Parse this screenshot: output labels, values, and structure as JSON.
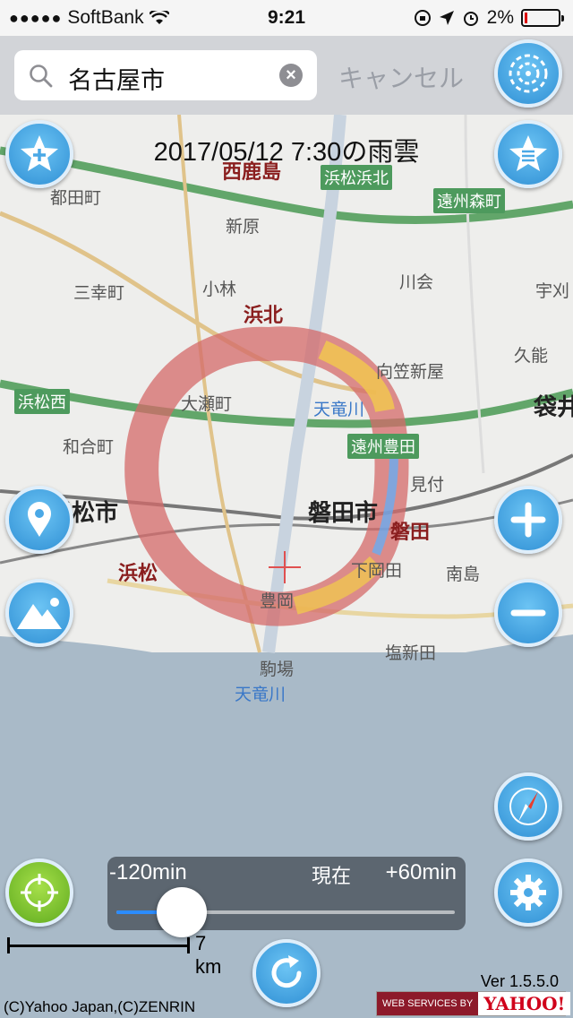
{
  "status": {
    "carrier": "SoftBank",
    "time": "9:21",
    "battery": "2%"
  },
  "search": {
    "value": "名古屋市",
    "cancel_label": "キャンセル"
  },
  "map": {
    "title": "2017/05/12 7:30の雨雲",
    "labels": [
      {
        "text": "西鹿島",
        "cls": "red"
      },
      {
        "text": "浜松浜北",
        "cls": "green"
      },
      {
        "text": "遠州森町",
        "cls": "green"
      },
      {
        "text": "新原",
        "cls": ""
      },
      {
        "text": "都田町",
        "cls": ""
      },
      {
        "text": "三幸町",
        "cls": ""
      },
      {
        "text": "小林",
        "cls": ""
      },
      {
        "text": "浜北",
        "cls": "red"
      },
      {
        "text": "川会",
        "cls": ""
      },
      {
        "text": "向笠新屋",
        "cls": ""
      },
      {
        "text": "浜松西",
        "cls": "green"
      },
      {
        "text": "大瀬町",
        "cls": ""
      },
      {
        "text": "天竜川",
        "cls": ""
      },
      {
        "text": "遠州豊田",
        "cls": "green"
      },
      {
        "text": "和合町",
        "cls": ""
      },
      {
        "text": "浜松市",
        "cls": "big"
      },
      {
        "text": "磐田市",
        "cls": "big"
      },
      {
        "text": "磐田",
        "cls": "red"
      },
      {
        "text": "浜松",
        "cls": "red"
      },
      {
        "text": "下岡田",
        "cls": ""
      },
      {
        "text": "南島",
        "cls": ""
      },
      {
        "text": "豊岡",
        "cls": ""
      },
      {
        "text": "塩新田",
        "cls": ""
      },
      {
        "text": "駒場",
        "cls": ""
      },
      {
        "text": "天竜川",
        "cls": ""
      },
      {
        "text": "袋井",
        "cls": "big"
      },
      {
        "text": "久能",
        "cls": ""
      },
      {
        "text": "宇刈",
        "cls": ""
      },
      {
        "text": "見付",
        "cls": ""
      }
    ]
  },
  "slider": {
    "left_label": "-120min",
    "center_label": "現在",
    "right_label": "+60min",
    "position": 0.12
  },
  "scale_label": "7 km",
  "version": "Ver 1.5.5.0",
  "copyright": "(C)Yahoo Japan,(C)ZENRIN",
  "yahoo": {
    "ws": "WEB SERVICES BY",
    "brand": "YAHOO!"
  }
}
